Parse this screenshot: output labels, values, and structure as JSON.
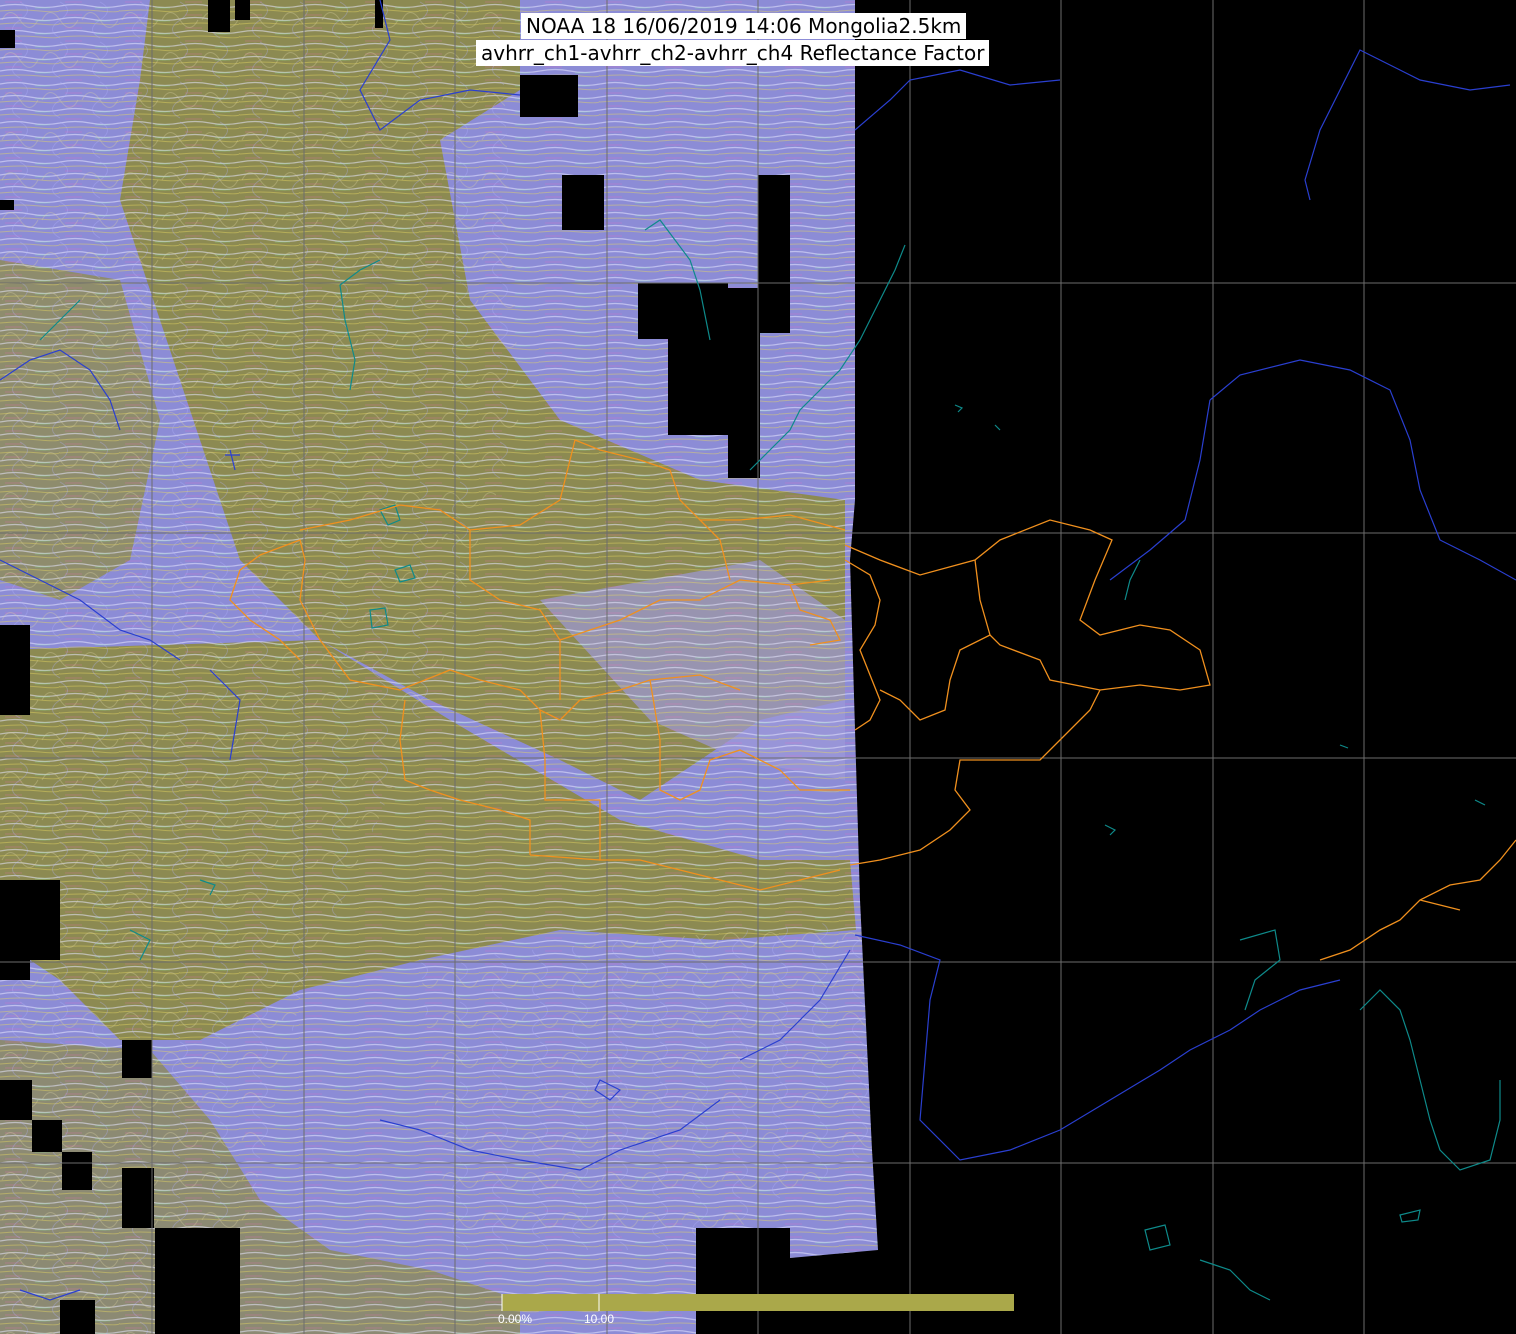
{
  "title": {
    "line1": "NOAA 18 16/06/2019 14:06 Mongolia2.5km",
    "line2": "avhrr_ch1-avhrr_ch2-avhrr_ch4 Reflectance Factor"
  },
  "colorbar": {
    "color": "#aaa84a",
    "ticks": [
      "0.00%",
      "10.00"
    ]
  },
  "colors": {
    "background": "#000000",
    "swath_olive": "#8c8a52",
    "swath_lavender": "#8c8cd6",
    "gridlines": "#6c6c6c",
    "coastlines": "#2a3fd0",
    "rivers_lakes": "#0e8a8a",
    "admin_borders": "#f0901e"
  }
}
